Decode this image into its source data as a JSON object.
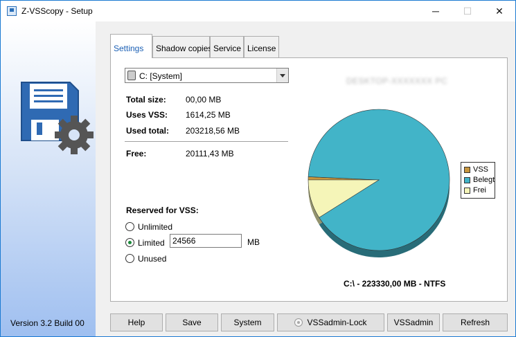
{
  "window": {
    "title": "Z-VSScopy - Setup",
    "minimize": "─",
    "maximize": "☐",
    "close": "✕"
  },
  "sidebar": {
    "version": "Version 3.2 Build 00"
  },
  "tabs": [
    "Settings",
    "Shadow copies",
    "Service",
    "License"
  ],
  "settings": {
    "drive_selected": "C:  [System]",
    "total_size_label": "Total size:",
    "total_size_value": "00,00 MB",
    "uses_vss_label": "Uses VSS:",
    "uses_vss_value": "1614,25 MB",
    "used_total_label": "Used total:",
    "used_total_value": "203218,56 MB",
    "free_label": "Free:",
    "free_value": "20111,43 MB",
    "reserved_title": "Reserved for VSS:",
    "radio_unlimited": "Unlimited",
    "radio_limited": "Limited",
    "radio_unused": "Unused",
    "limit_value": "24566",
    "limit_unit": "MB",
    "host_name": "DESKTOP-XXXXXXX PC",
    "footer": "C:\\ - 223330,00 MB - NTFS"
  },
  "chart_data": {
    "type": "pie",
    "series": [
      {
        "name": "VSS",
        "value": 1614.25,
        "color": "#c8963e"
      },
      {
        "name": "Belegt",
        "value": 203218.56,
        "color": "#42b4c8"
      },
      {
        "name": "Frei",
        "value": 20111.43,
        "color": "#f5f5b8"
      }
    ],
    "legend_position": "right"
  },
  "buttons": {
    "help": "Help",
    "save": "Save",
    "system": "System",
    "vssadmin_lock": "VSSadmin-Lock",
    "vssadmin": "VSSadmin",
    "refresh": "Refresh"
  },
  "icons": {
    "app": "app-icon",
    "floppy": "floppy-disk-icon",
    "gear": "gear-icon",
    "drive": "drive-icon",
    "dropdown": "chevron-down-icon"
  }
}
